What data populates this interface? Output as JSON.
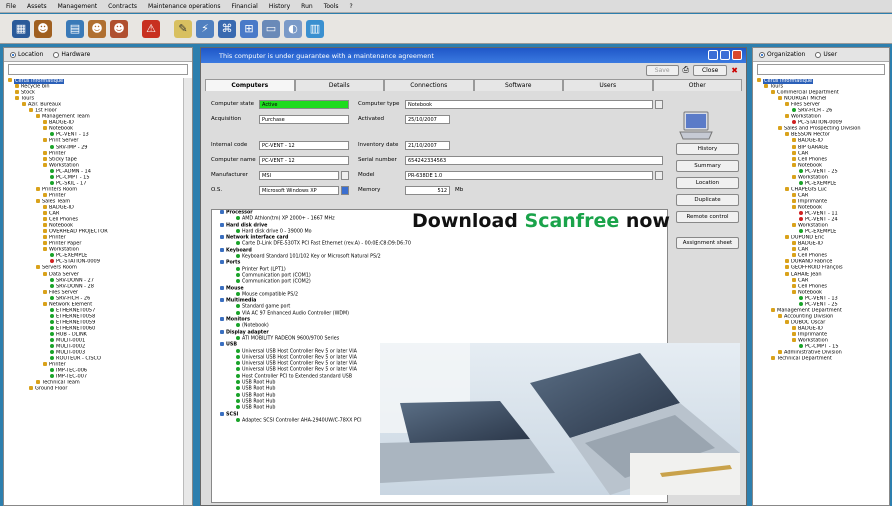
{
  "menu": [
    "File",
    "Assets",
    "Management",
    "Contracts",
    "Maintenance operations",
    "Financial",
    "History",
    "Run",
    "Tools",
    "?"
  ],
  "left_panel": {
    "options": [
      "Location",
      "Hardware"
    ],
    "tree": [
      {
        "t": "Cerus Informatique",
        "lv": 0,
        "sel": true
      },
      {
        "t": "Recycle bin",
        "lv": 1
      },
      {
        "t": "Stock",
        "lv": 1
      },
      {
        "t": "Tours",
        "lv": 1
      },
      {
        "t": "Azir. Bureaux",
        "lv": 2
      },
      {
        "t": "1st Floor",
        "lv": 3
      },
      {
        "t": "Management Team",
        "lv": 4
      },
      {
        "t": "BADGE-ID",
        "lv": 5
      },
      {
        "t": "Notebook",
        "lv": 5
      },
      {
        "t": "PC-VENT - 13",
        "lv": 6,
        "dot": "g"
      },
      {
        "t": "Print Server",
        "lv": 5
      },
      {
        "t": "SRV-IMP - 29",
        "lv": 6,
        "dot": "g"
      },
      {
        "t": "Printer",
        "lv": 5
      },
      {
        "t": "Sticky tape",
        "lv": 5
      },
      {
        "t": "Workstation",
        "lv": 5
      },
      {
        "t": "PC-ADMN - 14",
        "lv": 6,
        "dot": "g"
      },
      {
        "t": "PC-CMPT - 15",
        "lv": 6,
        "dot": "g"
      },
      {
        "t": "PC-SKIL - 17",
        "lv": 6,
        "dot": "g"
      },
      {
        "t": "Printers Room",
        "lv": 4
      },
      {
        "t": "Printer",
        "lv": 5
      },
      {
        "t": "Sales Team",
        "lv": 4
      },
      {
        "t": "BADGE-ID",
        "lv": 5
      },
      {
        "t": "CAR",
        "lv": 5
      },
      {
        "t": "Cell Phones",
        "lv": 5
      },
      {
        "t": "Notebook",
        "lv": 5
      },
      {
        "t": "OVERHEAD PROJECTOR",
        "lv": 5
      },
      {
        "t": "Printer",
        "lv": 5
      },
      {
        "t": "Printer Paper",
        "lv": 5
      },
      {
        "t": "Workstation",
        "lv": 5
      },
      {
        "t": "PC-EXEMPLE",
        "lv": 6,
        "dot": "g"
      },
      {
        "t": "PC-STATION-0009",
        "lv": 6,
        "dot": "r"
      },
      {
        "t": "Servers Room",
        "lv": 4
      },
      {
        "t": "Data Server",
        "lv": 5
      },
      {
        "t": "SRV-DONN - 27",
        "lv": 6,
        "dot": "g"
      },
      {
        "t": "SRV-DONN - 28",
        "lv": 6,
        "dot": "g"
      },
      {
        "t": "Files Server",
        "lv": 5
      },
      {
        "t": "SRV-FICH - 26",
        "lv": 6,
        "dot": "g"
      },
      {
        "t": "Network Element",
        "lv": 5
      },
      {
        "t": "ETHERNET0057",
        "lv": 6,
        "dot": "g"
      },
      {
        "t": "ETHERNET0058",
        "lv": 6,
        "dot": "g"
      },
      {
        "t": "ETHERNET0059",
        "lv": 6,
        "dot": "g"
      },
      {
        "t": "ETHERNET0060",
        "lv": 6,
        "dot": "g"
      },
      {
        "t": "HUB - DLINK",
        "lv": 6,
        "dot": "g"
      },
      {
        "t": "MULTI-0001",
        "lv": 6,
        "dot": "g"
      },
      {
        "t": "MULTI-0002",
        "lv": 6,
        "dot": "g"
      },
      {
        "t": "MULTI-0003",
        "lv": 6,
        "dot": "g"
      },
      {
        "t": "ROUTEUR - CISCO",
        "lv": 6,
        "dot": "g"
      },
      {
        "t": "Printer",
        "lv": 5
      },
      {
        "t": "IMP-TEC-006",
        "lv": 6,
        "dot": "g"
      },
      {
        "t": "IMP-TEC-007",
        "lv": 6,
        "dot": "g"
      },
      {
        "t": "Technical Team",
        "lv": 4
      },
      {
        "t": "Ground Floor",
        "lv": 3
      }
    ]
  },
  "right_panel": {
    "options": [
      "Organization",
      "User"
    ],
    "tree": [
      {
        "t": "Cerus Informatique",
        "lv": 0,
        "sel": true
      },
      {
        "t": "Tours",
        "lv": 1
      },
      {
        "t": "Commercial Department",
        "lv": 2
      },
      {
        "t": "NOURGAT Michel",
        "lv": 3
      },
      {
        "t": "Files Server",
        "lv": 4
      },
      {
        "t": "SRV-FICH - 26",
        "lv": 5,
        "dot": "g"
      },
      {
        "t": "Workstation",
        "lv": 4
      },
      {
        "t": "PC-STATION-0009",
        "lv": 5,
        "dot": "r"
      },
      {
        "t": "Sales and Prospecting Division",
        "lv": 3
      },
      {
        "t": "BESSON Hector",
        "lv": 4
      },
      {
        "t": "BADGE-ID",
        "lv": 5
      },
      {
        "t": "BIP GARAGE",
        "lv": 5
      },
      {
        "t": "CAR",
        "lv": 5
      },
      {
        "t": "Cell Phones",
        "lv": 5
      },
      {
        "t": "Notebook",
        "lv": 5
      },
      {
        "t": "PC-VENT - 25",
        "lv": 6,
        "dot": "g"
      },
      {
        "t": "Workstation",
        "lv": 5
      },
      {
        "t": "PC-EXEMPLE",
        "lv": 6,
        "dot": "g"
      },
      {
        "t": "CHAPEGIS Luc",
        "lv": 4
      },
      {
        "t": "CAR",
        "lv": 5
      },
      {
        "t": "Imprimante",
        "lv": 5
      },
      {
        "t": "Notebook",
        "lv": 5
      },
      {
        "t": "PC-VENT - 11",
        "lv": 6,
        "dot": "r"
      },
      {
        "t": "PC-VENT - 24",
        "lv": 6,
        "dot": "r"
      },
      {
        "t": "Workstation",
        "lv": 5
      },
      {
        "t": "PC-EXEMPLE",
        "lv": 6,
        "dot": "g"
      },
      {
        "t": "DUPOND Eric",
        "lv": 4
      },
      {
        "t": "BADGE-ID",
        "lv": 5
      },
      {
        "t": "CAR",
        "lv": 5
      },
      {
        "t": "Cell Phones",
        "lv": 5
      },
      {
        "t": "DURAND Fabrice",
        "lv": 4
      },
      {
        "t": "GEOFFROID François",
        "lv": 4
      },
      {
        "t": "LAHAIE Jean",
        "lv": 4
      },
      {
        "t": "CAR",
        "lv": 5
      },
      {
        "t": "Cell Phones",
        "lv": 5
      },
      {
        "t": "Notebook",
        "lv": 5
      },
      {
        "t": "PC-VENT - 13",
        "lv": 6,
        "dot": "g"
      },
      {
        "t": "PC-VENT - 25",
        "lv": 6,
        "dot": "g"
      },
      {
        "t": "Management Department",
        "lv": 2
      },
      {
        "t": "Accounting Division",
        "lv": 3
      },
      {
        "t": "DUBOC Oscar",
        "lv": 4
      },
      {
        "t": "BADGE-ID",
        "lv": 5
      },
      {
        "t": "Imprimante",
        "lv": 5
      },
      {
        "t": "Workstation",
        "lv": 5
      },
      {
        "t": "PC-CMPT - 15",
        "lv": 6,
        "dot": "g"
      },
      {
        "t": "Administrative Division",
        "lv": 3
      },
      {
        "t": "Technical Department",
        "lv": 2
      }
    ]
  },
  "window": {
    "title": "This computer is under guarantee with a maintenance agreement",
    "buttons": {
      "save": "Save",
      "close": "Close"
    },
    "tabs": [
      "Computers",
      "Details",
      "Connections",
      "Software",
      "Users",
      "Other"
    ],
    "form": {
      "computer_state_label": "Computer state",
      "computer_state": "Active",
      "computer_type_label": "Computer type",
      "computer_type": "Notebook",
      "acquisition_label": "Acquisition",
      "acquisition": "Purchase",
      "activated_label": "Activated",
      "activated": "25/10/2007",
      "internal_code_label": "Internal code",
      "internal_code": "PC-VENT - 12",
      "inventory_date_label": "Inventory date",
      "inventory_date": "21/10/2007",
      "computer_name_label": "Computer name",
      "computer_name": "PC-VENT - 12",
      "serial_label": "Serial number",
      "serial": "654242334563",
      "manufacturer_label": "Manufacturer",
      "manufacturer": "MSI",
      "model_label": "Model",
      "model": "PR-638DE 1.0",
      "os_label": "O.S.",
      "os": "Microsoft Windows XP",
      "memory_label": "Memory",
      "memory": "512",
      "memory_unit": "Mb"
    },
    "side_buttons": [
      "History",
      "Summary",
      "Location",
      "Duplicate",
      "Remote control",
      "Assignment sheet"
    ],
    "hardware": [
      {
        "t": "Processor",
        "cat": true
      },
      {
        "t": "AMD Athlon(tm) XP 2000+ - 1667 MHz"
      },
      {
        "t": "Hard disk drive",
        "cat": true
      },
      {
        "t": "Hard disk drive 0 - 39000 Mo"
      },
      {
        "t": "Network interface card",
        "cat": true
      },
      {
        "t": "Carte D-Link DFE-530TX PCI Fast Ethernet (rev.A) - 00:0E:C8:D9:D6:70"
      },
      {
        "t": "Keyboard",
        "cat": true
      },
      {
        "t": "Keyboard Standard 101/102 Key or Microsoft Natural PS/2"
      },
      {
        "t": "Ports",
        "cat": true
      },
      {
        "t": "Printer Port (LPT1)"
      },
      {
        "t": "Communication port (COM1)"
      },
      {
        "t": "Communication port (COM2)"
      },
      {
        "t": "Mouse",
        "cat": true
      },
      {
        "t": "Mouse compatible PS/2"
      },
      {
        "t": "Multimedia",
        "cat": true
      },
      {
        "t": "Standard game port"
      },
      {
        "t": "VIA AC 97 Enhanced Audio Controller (WDM)"
      },
      {
        "t": "Monitors",
        "cat": true
      },
      {
        "t": "(Notebook)"
      },
      {
        "t": "Display adapter",
        "cat": true
      },
      {
        "t": "ATI MOBILITY RADEON 9600/9700 Series"
      },
      {
        "t": "USB",
        "cat": true
      },
      {
        "t": "Universal USB Host Controller Rev 5 or later VIA"
      },
      {
        "t": "Universal USB Host Controller Rev 5 or later VIA"
      },
      {
        "t": "Universal USB Host Controller Rev 5 or later VIA"
      },
      {
        "t": "Universal USB Host Controller Rev 5 or later VIA"
      },
      {
        "t": "Host Controller PCI to Extended standard USB"
      },
      {
        "t": "USB Root Hub"
      },
      {
        "t": "USB Root Hub"
      },
      {
        "t": "USB Root Hub"
      },
      {
        "t": "USB Root Hub"
      },
      {
        "t": "USB Root Hub"
      },
      {
        "t": "SCSI",
        "cat": true
      },
      {
        "t": "Adaptec SCSI Controller AHA-2940UW/C-78XX PCI"
      }
    ]
  },
  "banner": {
    "part1": "Download ",
    "part2": "Scanfree",
    "part3": " now"
  },
  "colors": {
    "accent": "#1f57c8",
    "active_state": "#1fdc1f",
    "ok": "#1aa32a",
    "alert": "#d02020"
  }
}
